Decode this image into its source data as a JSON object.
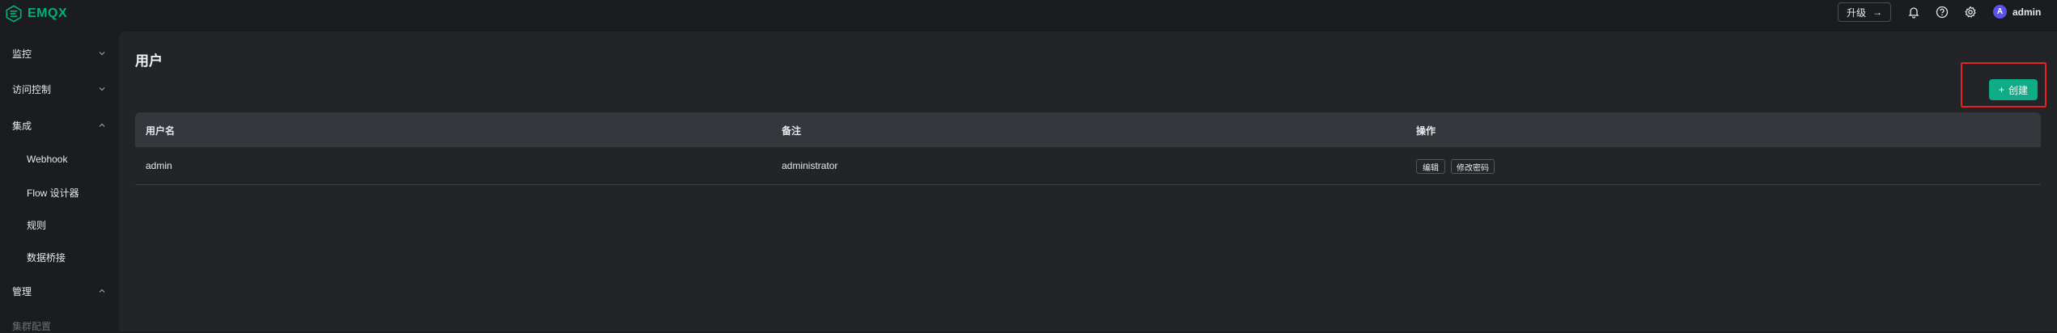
{
  "app": {
    "logo_text": "EMQX",
    "brand_color": "#00b173",
    "accent_color": "#0ead87"
  },
  "topbar": {
    "upgrade_label": "升级",
    "user_initial": "A",
    "user_name": "admin",
    "icons": [
      "bell-icon",
      "help-icon",
      "gear-icon"
    ]
  },
  "sidebar": {
    "items": [
      {
        "label": "监控",
        "expanded": false
      },
      {
        "label": "访问控制",
        "expanded": false
      },
      {
        "label": "集成",
        "expanded": true
      },
      {
        "label": "管理",
        "expanded": true
      }
    ],
    "integration_subitems": [
      "Webhook",
      "Flow 设计器",
      "规则",
      "数据桥接"
    ],
    "management_subitems": [
      "集群配置"
    ]
  },
  "main": {
    "title": "用户",
    "create_label": "创建",
    "table": {
      "headers": [
        "用户名",
        "备注",
        "操作"
      ],
      "rows": [
        {
          "username": "admin",
          "remark": "administrator",
          "actions": [
            "编辑",
            "修改密码"
          ]
        }
      ]
    }
  }
}
